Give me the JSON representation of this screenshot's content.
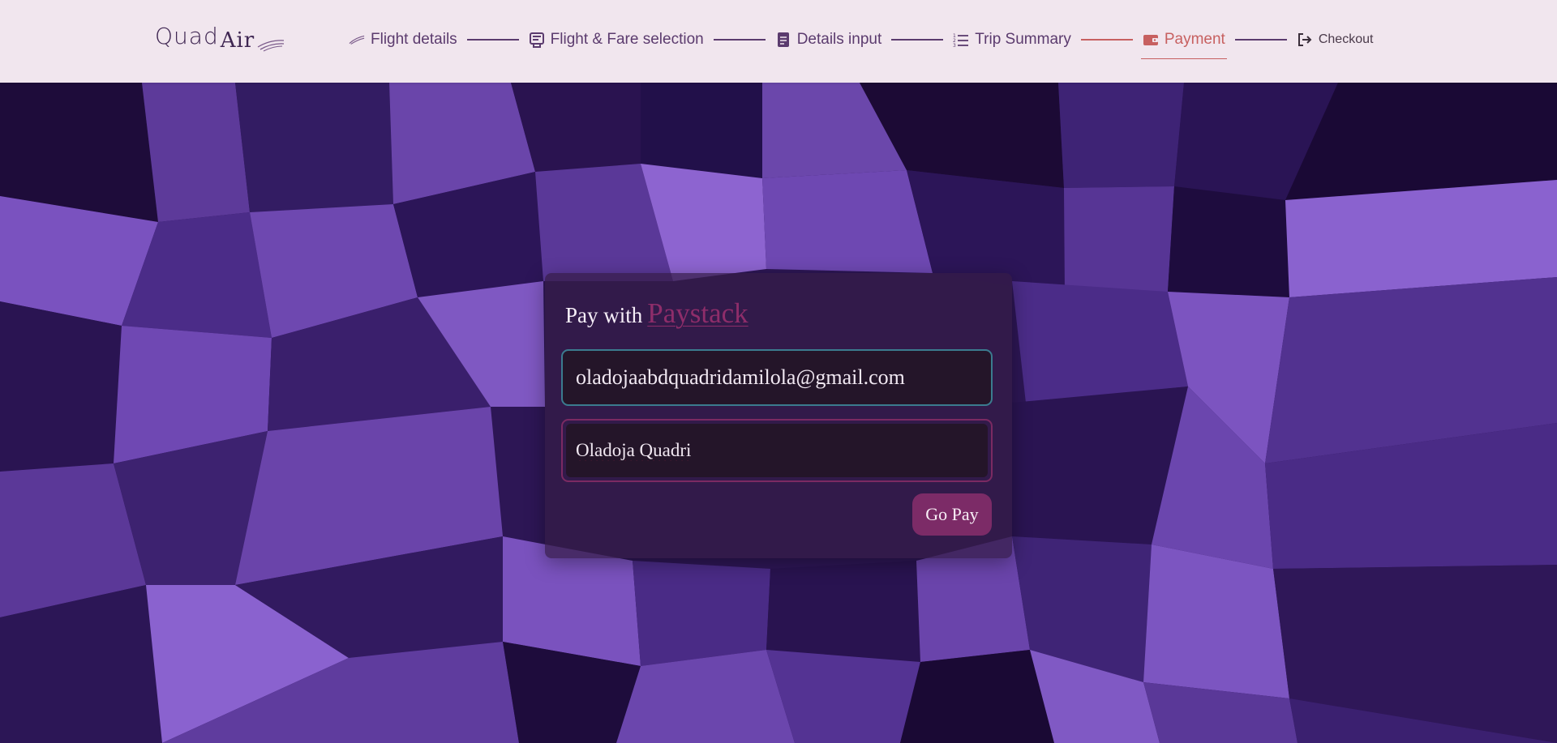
{
  "brand": {
    "logo_part1": "Quad",
    "logo_part2": "Air"
  },
  "steps": [
    {
      "label": "Flight details",
      "icon": "plane-takeoff-icon"
    },
    {
      "label": "Flight & Fare selection",
      "icon": "ticket-icon"
    },
    {
      "label": "Details input",
      "icon": "document-icon"
    },
    {
      "label": "Trip Summary",
      "icon": "list-icon"
    },
    {
      "label": "Payment",
      "icon": "wallet-icon",
      "active": true
    },
    {
      "label": "Checkout",
      "icon": "sign-out-icon"
    }
  ],
  "payment": {
    "title_prefix": "Pay with",
    "provider": "Paystack",
    "email_value": "oladojaabdquadridamilola@gmail.com",
    "name_value": "Oladoja Quadri",
    "submit_label": "Go Pay"
  },
  "colors": {
    "header_bg": "#f1e6ee",
    "accent": "#7c2b67",
    "active_step": "#c76060",
    "step_text": "#5b3b6e"
  }
}
